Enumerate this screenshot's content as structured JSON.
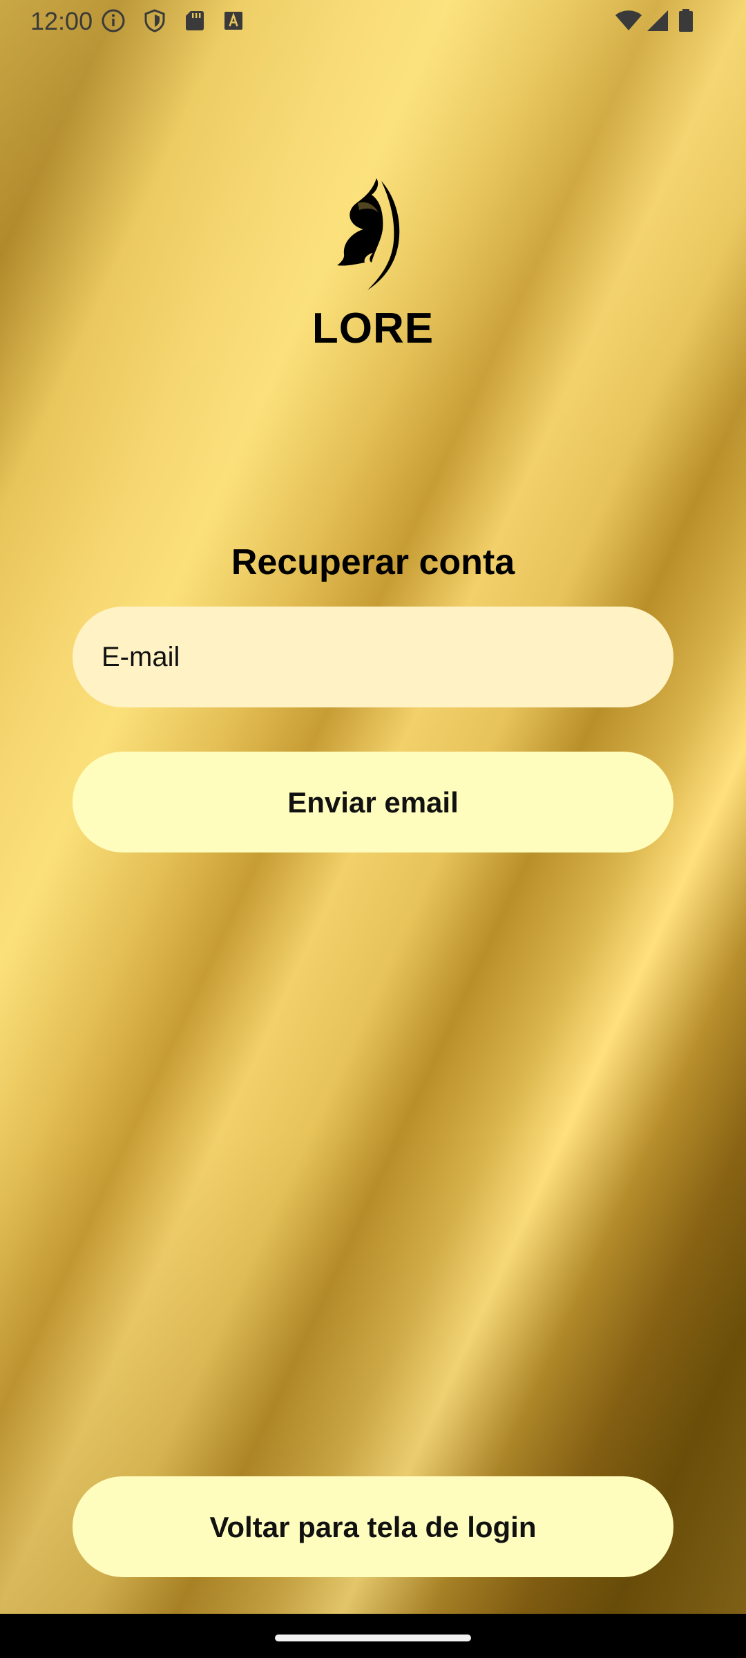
{
  "status_bar": {
    "time": "12:00",
    "left_icons": [
      "info-icon",
      "shield-icon",
      "sd-card-icon",
      "text-a-icon"
    ],
    "right_icons": [
      "wifi-icon",
      "signal-icon",
      "battery-icon"
    ]
  },
  "brand": {
    "name": "LORE",
    "logo_icon": "butterfly-icon"
  },
  "recover": {
    "heading": "Recuperar conta",
    "email_placeholder": "E-mail",
    "send_label": "Enviar email"
  },
  "footer": {
    "back_label": "Voltar para tela de login"
  },
  "colors": {
    "field_background": "#fff2c4",
    "button_background": "#fffdbd",
    "gold_light": "#fbe07a",
    "gold_dark": "#6e520a"
  }
}
